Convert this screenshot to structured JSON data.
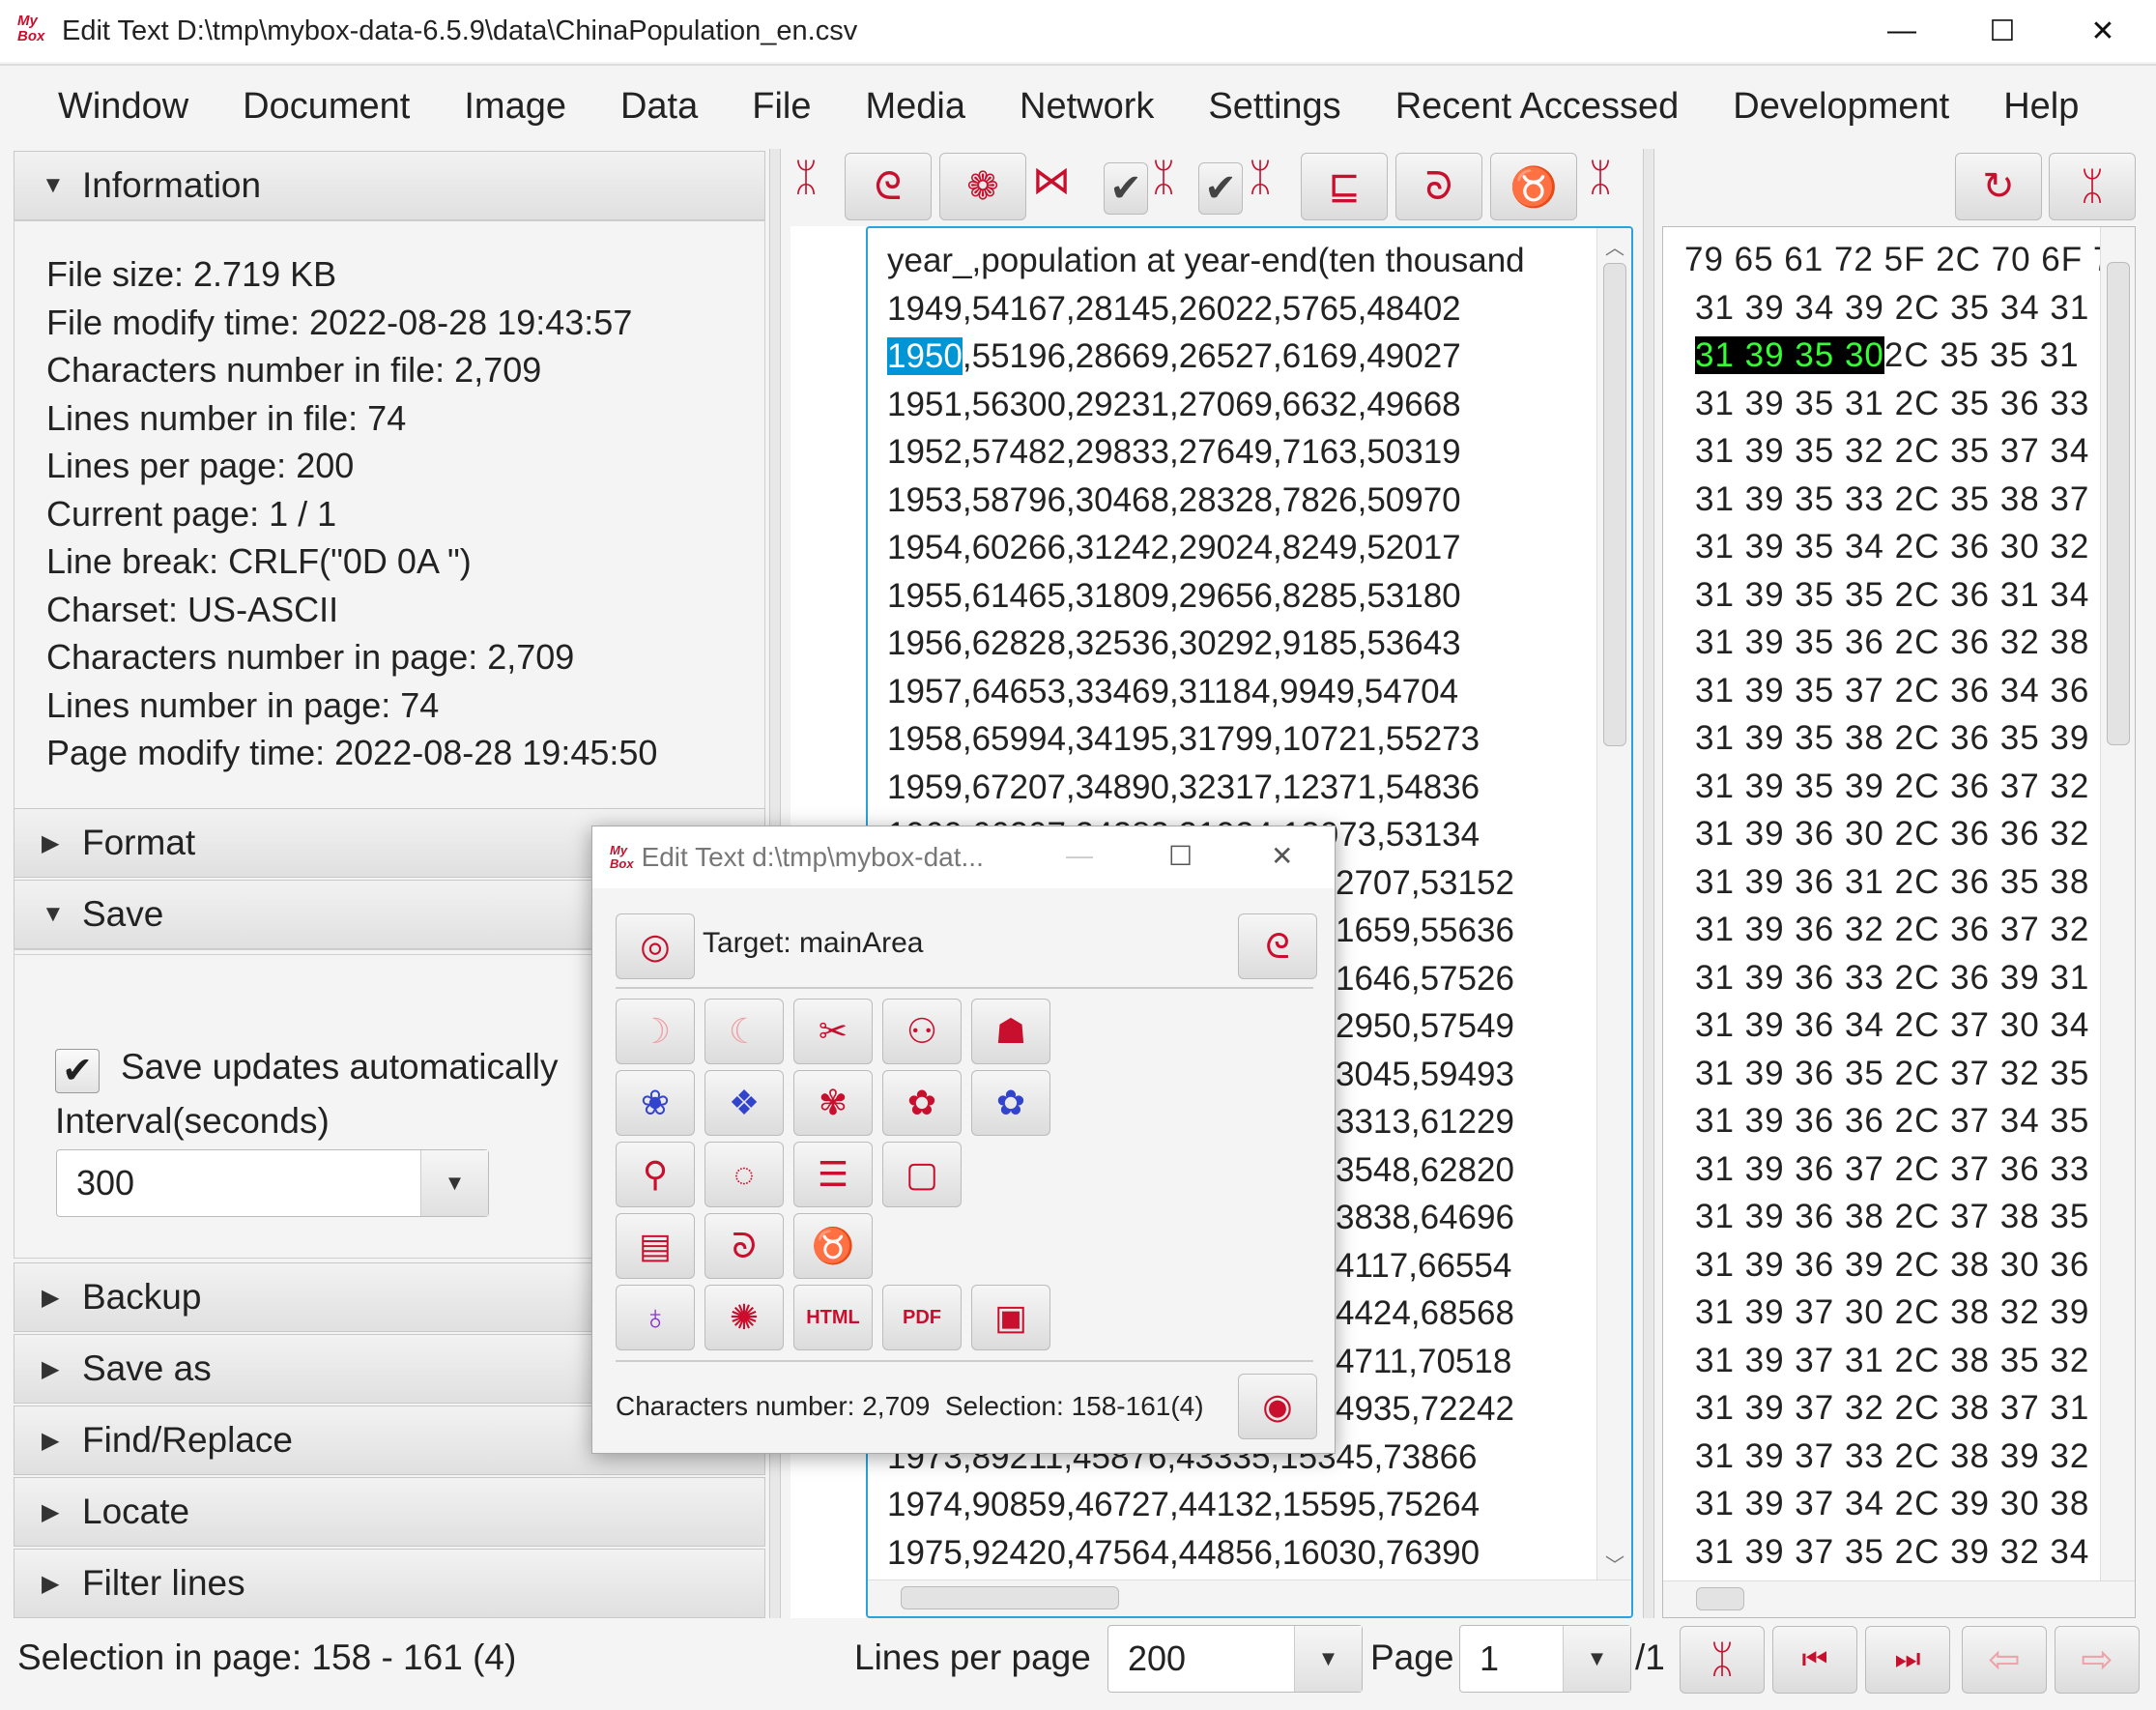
{
  "window": {
    "title": "Edit Text  D:\\tmp\\mybox-data-6.5.9\\data\\ChinaPopulation_en.csv",
    "logo": "MyBox",
    "minimize": "—",
    "maximize": "☐",
    "close": "✕"
  },
  "menu": [
    "Window",
    "Document",
    "Image",
    "Data",
    "File",
    "Media",
    "Network",
    "Settings",
    "Recent Accessed",
    "Development",
    "Help"
  ],
  "left": {
    "information_label": "Information",
    "info": [
      "File size: 2.719 KB",
      "File modify time: 2022-08-28 19:43:57",
      "Characters number in file: 2,709",
      "Lines number in file: 74",
      "Lines per page: 200",
      "Current page: 1 / 1",
      "Line break: CRLF(\"0D 0A \")",
      "Charset: US-ASCII",
      "Characters number in page: 2,709",
      "Lines number in page: 74",
      "Page modify time: 2022-08-28 19:45:50"
    ],
    "format_label": "Format",
    "save_label": "Save",
    "auto_save_label": "Save updates automatically",
    "auto_save_checked": true,
    "interval_label": "Interval(seconds)",
    "interval_value": "300",
    "backup_label": "Backup",
    "saveas_label": "Save as",
    "find_label": "Find/Replace",
    "locate_label": "Locate",
    "filter_label": "Filter lines"
  },
  "text": {
    "selected": "1950",
    "lines": [
      {
        "t": "year_,population at year-end(ten thousand"
      },
      {
        "t": "1949,54167,28145,26022,5765,48402"
      },
      {
        "t": ",55196,28669,26527,6169,49027",
        "sel": "1950"
      },
      {
        "t": "1951,56300,29231,27069,6632,49668"
      },
      {
        "t": "1952,57482,29833,27649,7163,50319"
      },
      {
        "t": "1953,58796,30468,28328,7826,50970"
      },
      {
        "t": "1954,60266,31242,29024,8249,52017"
      },
      {
        "t": "1955,61465,31809,29656,8285,53180"
      },
      {
        "t": "1956,62828,32536,30292,9185,53643"
      },
      {
        "t": "1957,64653,33469,31184,9949,54704"
      },
      {
        "t": "1958,65994,34195,31799,10721,55273"
      },
      {
        "t": "1959,67207,34890,32317,12371,54836"
      },
      {
        "t": "1960,66207,34283,31924,13073,53134"
      },
      {
        "t": "2707,53152",
        "tail": true
      },
      {
        "t": "1659,55636",
        "tail": true
      },
      {
        "t": "1646,57526",
        "tail": true
      },
      {
        "t": "2950,57549",
        "tail": true
      },
      {
        "t": "3045,59493",
        "tail": true
      },
      {
        "t": "3313,61229",
        "tail": true
      },
      {
        "t": "3548,62820",
        "tail": true
      },
      {
        "t": "3838,64696",
        "tail": true
      },
      {
        "t": "4117,66554",
        "tail": true
      },
      {
        "t": "4424,68568",
        "tail": true
      },
      {
        "t": "4711,70518",
        "tail": true
      },
      {
        "t": "4935,72242",
        "tail": true
      },
      {
        "t": "1973,89211,45876,43335,15345,73866"
      },
      {
        "t": "1974,90859,46727,44132,15595,75264"
      },
      {
        "t": "1975,92420,47564,44856,16030,76390"
      }
    ]
  },
  "hex": {
    "selected": "31 39 35 30",
    "lines": [
      "79 65 61 72 5F 2C 70 6F 7",
      "31 39 34 39 2C 35 34 31",
      "2C 35 35 31",
      "31 39 35 31 2C 35 36 33",
      "31 39 35 32 2C 35 37 34",
      "31 39 35 33 2C 35 38 37",
      "31 39 35 34 2C 36 30 32",
      "31 39 35 35 2C 36 31 34",
      "31 39 35 36 2C 36 32 38",
      "31 39 35 37 2C 36 34 36",
      "31 39 35 38 2C 36 35 39",
      "31 39 35 39 2C 36 37 32",
      "31 39 36 30 2C 36 36 32",
      "31 39 36 31 2C 36 35 38",
      "31 39 36 32 2C 36 37 32",
      "31 39 36 33 2C 36 39 31",
      "31 39 36 34 2C 37 30 34",
      "31 39 36 35 2C 37 32 35",
      "31 39 36 36 2C 37 34 35",
      "31 39 36 37 2C 37 36 33",
      "31 39 36 38 2C 37 38 35",
      "31 39 36 39 2C 38 30 36",
      "31 39 37 30 2C 38 32 39",
      "31 39 37 31 2C 38 35 32",
      "31 39 37 32 2C 38 37 31",
      "31 39 37 33 2C 38 39 32",
      "31 39 37 34 2C 39 30 38",
      "31 39 37 35 2C 39 32 34"
    ]
  },
  "status": {
    "selection": "Selection in page: 158 - 161 (4)",
    "lines_per_page_label": "Lines per page",
    "lines_per_page": "200",
    "page_label": "Page",
    "page": "1",
    "page_total": "/1"
  },
  "dialog": {
    "title": "Edit Text  d:\\tmp\\mybox-dat...",
    "target": "Target: mainArea",
    "chars": "Characters number: 2,709",
    "selection": "Selection: 158-161(4)",
    "buttons": [
      {
        "name": "undo",
        "g": "☽",
        "c": "#f0a0a8"
      },
      {
        "name": "redo",
        "g": "☾",
        "c": "#f0a0a8"
      },
      {
        "name": "cut",
        "g": "✂",
        "c": "#c8102e"
      },
      {
        "name": "copy",
        "g": "⚇",
        "c": "#c8102e"
      },
      {
        "name": "paste",
        "g": "☗",
        "c": "#c8102e"
      },
      {
        "name": "snap-1",
        "g": "❀",
        "c": "#3344cc"
      },
      {
        "name": "snap-2",
        "g": "❖",
        "c": "#3344cc"
      },
      {
        "name": "snap-3",
        "g": "✾",
        "c": "#c8102e"
      },
      {
        "name": "snap-4",
        "g": "✿",
        "c": "#c8102e"
      },
      {
        "name": "snap-5",
        "g": "✿",
        "c": "#3344cc"
      },
      {
        "name": "find",
        "g": "⚲",
        "c": "#c8102e"
      },
      {
        "name": "refresh",
        "g": "◌",
        "c": "#c8102e"
      },
      {
        "name": "select-all",
        "g": "☰",
        "c": "#c8102e"
      },
      {
        "name": "select-none",
        "g": "▢",
        "c": "#c8102e"
      },
      null,
      {
        "name": "list",
        "g": "▤",
        "c": "#c8102e"
      },
      {
        "name": "swirl",
        "g": "ᘐ",
        "c": "#c8102e"
      },
      {
        "name": "gourd",
        "g": "♉",
        "c": "#c8102e"
      },
      null,
      null,
      {
        "name": "palette",
        "g": "♁",
        "c": "#8833cc"
      },
      {
        "name": "flower",
        "g": "✺",
        "c": "#c8102e"
      },
      {
        "name": "html",
        "g": "HTML",
        "c": "#c8102e"
      },
      {
        "name": "pdf",
        "g": "PDF",
        "c": "#c8102e"
      },
      {
        "name": "snapshot",
        "g": "▣",
        "c": "#c8102e"
      }
    ]
  },
  "colors": {
    "accent": "#c8102e",
    "selection_bg": "#0096d6",
    "hex_selection_bg": "#000000",
    "hex_selection_fg": "#33ff33",
    "focus_border": "#29a3d9"
  }
}
